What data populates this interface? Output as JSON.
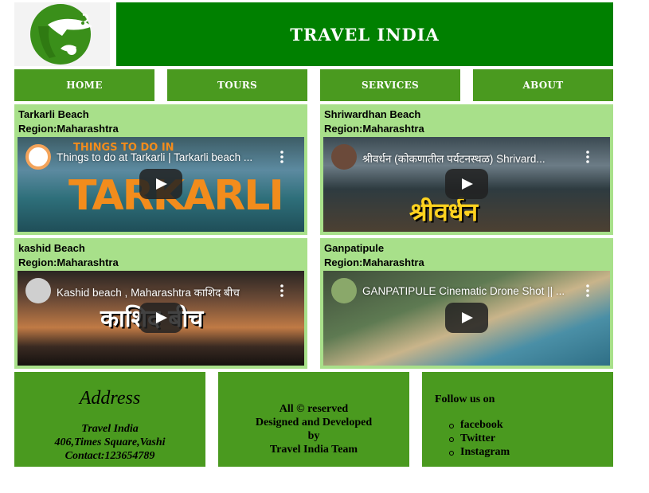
{
  "site": {
    "title": "TRAVEL INDIA"
  },
  "nav": {
    "items": [
      "HOME",
      "TOURS",
      "SERVICES",
      "ABOUT"
    ]
  },
  "cards": [
    {
      "name": "Tarkarli Beach",
      "region": "Region:Maharashtra",
      "video_title": "Things to do at Tarkarli | Tarkarli beach ...",
      "overlay": "TARKARLI",
      "overlay_top": "THINGS TO DO IN"
    },
    {
      "name": "Shriwardhan Beach",
      "region": "Region:Maharashtra",
      "video_title": "श्रीवर्धन (कोकणातील पर्यटनस्थळ) Shrivard...",
      "overlay": "श्रीवर्धन"
    },
    {
      "name": "kashid Beach",
      "region": "Region:Maharashtra",
      "video_title": "Kashid beach , Maharashtra काशिद बीच",
      "overlay": "काशिद बीच"
    },
    {
      "name": "Ganpatipule",
      "region": "Region:Maharashtra",
      "video_title": "GANPATIPULE Cinematic Drone Shot || ...",
      "overlay": ""
    }
  ],
  "footer": {
    "address": {
      "heading": "Address",
      "lines": [
        "Travel India",
        "406,Times Square,Vashi",
        "Contact:123654789"
      ]
    },
    "credits": {
      "lines": [
        "All © reserved",
        "Designed and Developed",
        "by",
        "Travel India Team"
      ]
    },
    "follow": {
      "heading": "Follow us on",
      "links": [
        "facebook",
        "Twitter",
        "Instagram"
      ]
    }
  },
  "colors": {
    "banner": "#008000",
    "nav": "#4a9a1f",
    "card": "#a8e08a",
    "footer": "#4a9a1f"
  }
}
